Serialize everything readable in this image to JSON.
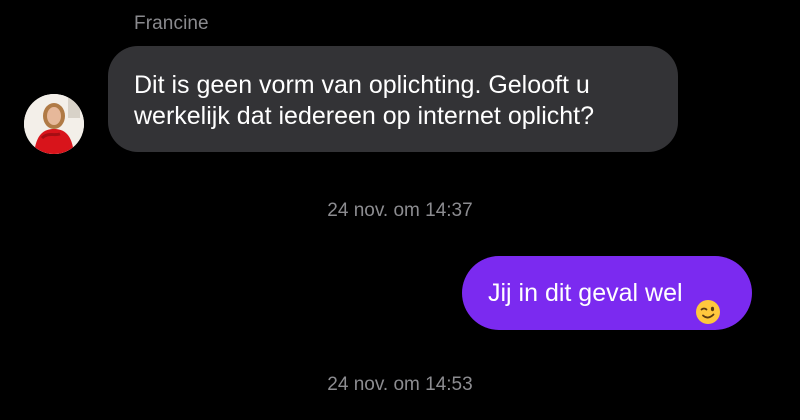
{
  "conversation": {
    "contact_name": "Francine",
    "messages": [
      {
        "direction": "incoming",
        "text": "Dit is geen vorm van oplichting. Gelooft u werkelijk dat iedereen op internet oplicht?"
      },
      {
        "direction": "outgoing",
        "text": "Jij in dit geval wel",
        "emoji": "winking-face-emoji"
      }
    ],
    "timestamps": [
      "24 nov. om 14:37",
      "24 nov. om 14:53"
    ]
  },
  "colors": {
    "background": "#000000",
    "incoming_bubble": "#333336",
    "outgoing_bubble": "#7b2af0",
    "meta_text": "#8c8c90"
  }
}
